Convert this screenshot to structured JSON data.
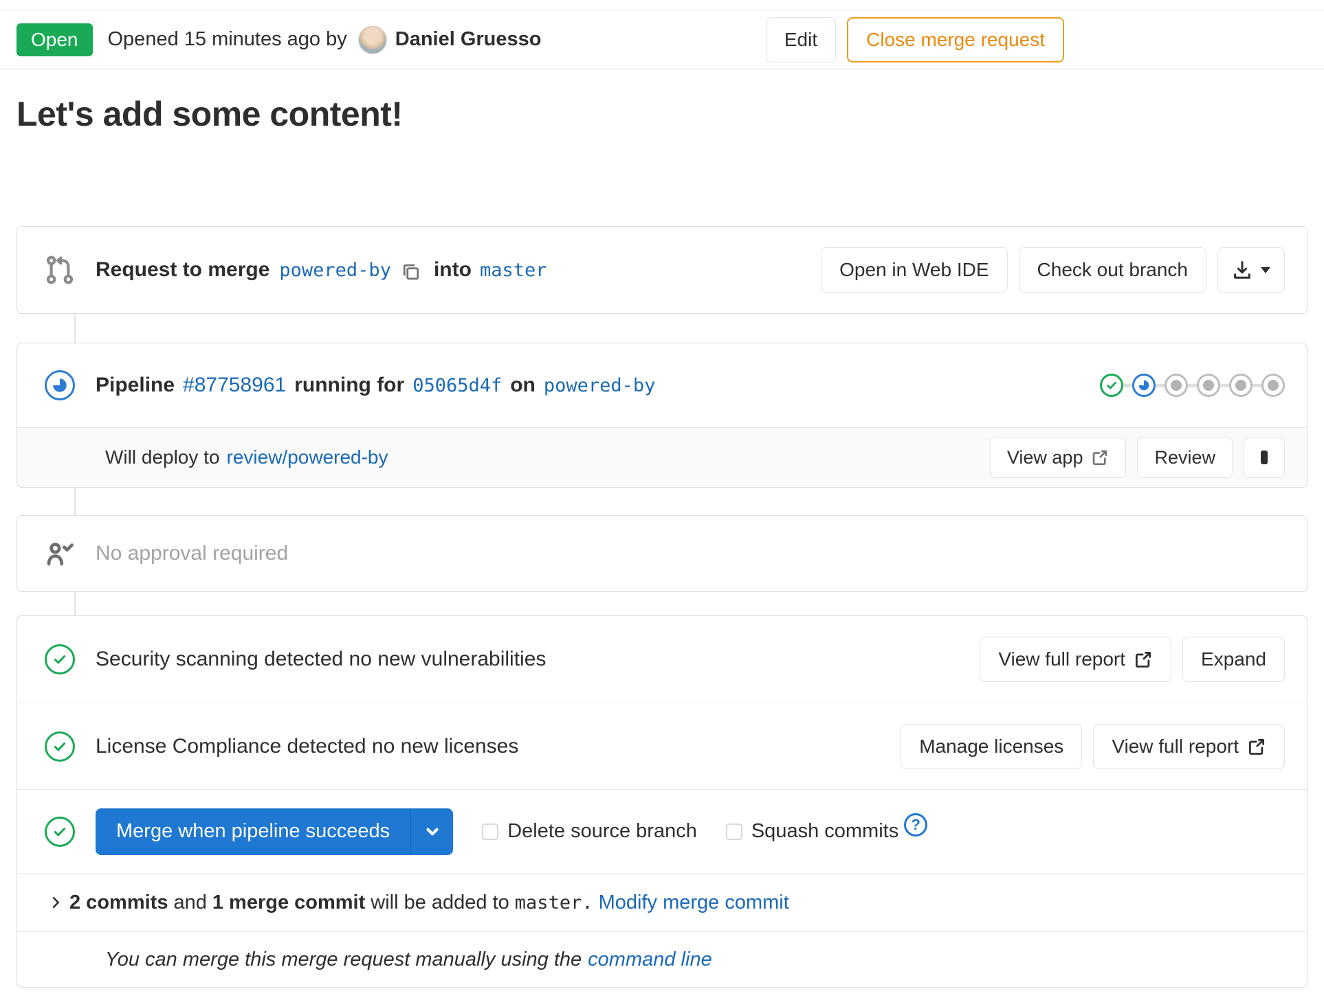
{
  "colors": {
    "green": "#1aaa55",
    "blue": "#1f78d1",
    "link": "#1b69b6",
    "orange": "#e8890c",
    "muted_gray": "#a2a2a2"
  },
  "icons": [
    "merge-request-icon",
    "copy-icon",
    "download-icon",
    "caret-down-icon",
    "pipeline-running-icon",
    "check-circle-icon",
    "approval-person-check-icon",
    "external-link-icon",
    "stop-icon",
    "help-question-icon",
    "chevron-right-icon",
    "chevron-down-icon"
  ],
  "header": {
    "status_label": "Open",
    "opened_text": "Opened 15 minutes ago by",
    "author": "Daniel Gruesso",
    "edit_label": "Edit",
    "close_label": "Close merge request"
  },
  "title": "Let's add some content!",
  "merge_source": {
    "request_to_merge": "Request to merge",
    "source_branch": "powered-by",
    "into": "into",
    "target_branch": "master",
    "open_web_ide": "Open in Web IDE",
    "check_out_branch": "Check out branch"
  },
  "pipeline": {
    "label": "Pipeline",
    "id": "#87758961",
    "running_for": "running for",
    "commit": "05065d4f",
    "on": "on",
    "branch": "powered-by",
    "stages": [
      "passed",
      "running",
      "created",
      "created",
      "created",
      "created"
    ],
    "deploy": {
      "text": "Will deploy to",
      "env_link": "review/powered-by",
      "view_app": "View app",
      "review": "Review"
    }
  },
  "approval": {
    "text": "No approval required"
  },
  "reports": [
    {
      "text": "Security scanning detected no new vulnerabilities",
      "primary_button": "View full report",
      "secondary_button": "Expand"
    },
    {
      "text": "License Compliance detected no new licenses",
      "primary_button": "Manage licenses",
      "secondary_button": "View full report"
    }
  ],
  "merge_actions": {
    "merge_button": "Merge when pipeline succeeds",
    "delete_source_branch": "Delete source branch",
    "squash_commits": "Squash commits",
    "help": "?"
  },
  "commits_summary": {
    "count": "2 commits",
    "and": "and",
    "merge_commit": "1 merge commit",
    "will_be_added": "will be added to",
    "target": "master.",
    "modify_link": "Modify merge commit"
  },
  "manual_merge": {
    "text": "You can merge this merge request manually using the",
    "link": "command line"
  }
}
